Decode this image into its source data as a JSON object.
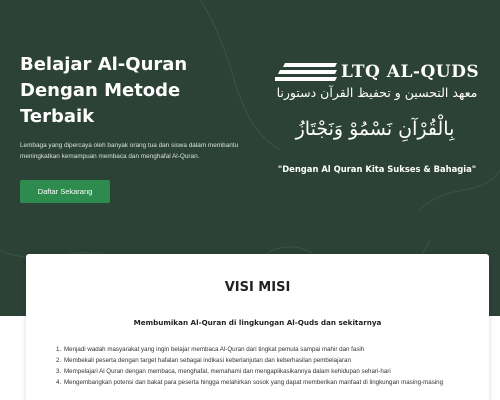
{
  "hero": {
    "title": "Belajar Al-Quran Dengan Metode Terbaik",
    "description": "Lembaga yang dipercaya oleh banyak orang tua dan siswa dalam membantu meningkatkan kemampuan membaca dan menghafal Al-Quran.",
    "cta_label": "Daftar Sekarang"
  },
  "logo": {
    "name": "LTQ AL-QUDS",
    "arabic_subtitle": "معهد التحسين و تحفيظ القرآن دستورنا",
    "calligraphy": "بِالْقُرْآنِ نَسْمُوْ وَنَجْتَازُ",
    "tagline": "\"Dengan Al Quran Kita Sukses & Bahagia\""
  },
  "visi_misi": {
    "title": "VISI MISI",
    "subtitle": "Membumikan Al-Quran di lingkungan Al-Quds dan sekitarnya",
    "items": [
      {
        "num": "1.",
        "text": "Menjadi wadah masyarakat yang ingin belajar membaca Al-Quran dari tingkat pemula sampai mahir dan fasih"
      },
      {
        "num": "2.",
        "text": "Membekali peserta dengan target hafalan sebagai indikasi keberlanjutan dan keberhasilan pembelajaran"
      },
      {
        "num": "3.",
        "text": "Mempelajari Al Quran dengan membaca, menghafal, memahami dan mengaplikasikannya dalam kehidupan sehari-hari"
      },
      {
        "num": "4.",
        "text": "Mengembangkan potensi dan bakat para peserta hingga melahirkan sosok yang dapat memberikan manfaat di lingkungan masing-masing"
      }
    ]
  },
  "colors": {
    "hero_background": "#2c4236",
    "cta_background": "#2e8b4e",
    "card_background": "#ffffff"
  }
}
